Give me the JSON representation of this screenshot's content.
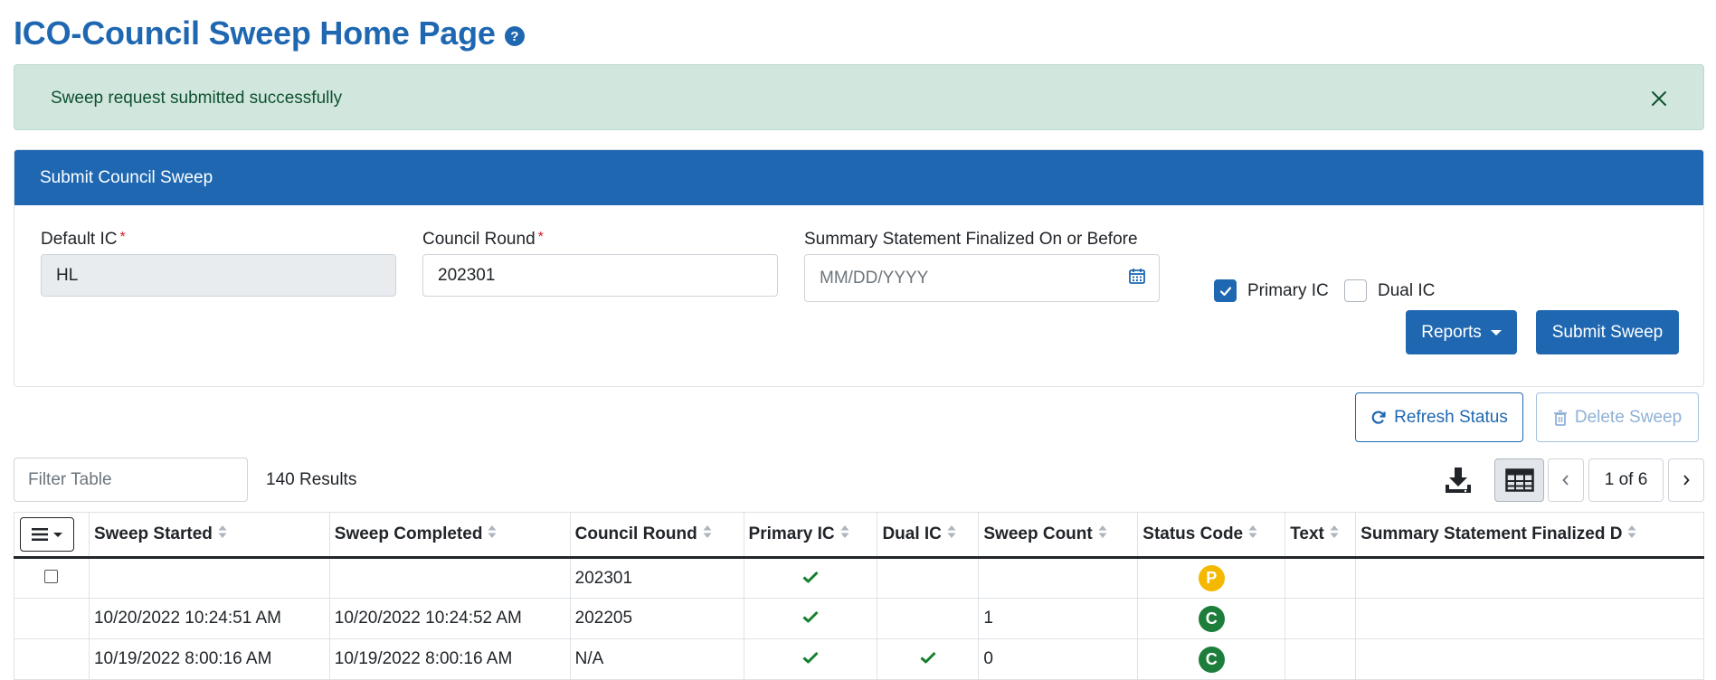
{
  "page": {
    "title": "ICO-Council Sweep Home Page"
  },
  "alert": {
    "message": "Sweep request submitted successfully"
  },
  "panel": {
    "header": "Submit Council Sweep",
    "default_ic": {
      "label": "Default IC",
      "value": "HL"
    },
    "council_round": {
      "label": "Council Round",
      "value": "202301"
    },
    "summary_date": {
      "label": "Summary Statement Finalized On or Before",
      "placeholder": "MM/DD/YYYY"
    },
    "primary_ic": {
      "label": "Primary IC",
      "checked": true
    },
    "dual_ic": {
      "label": "Dual IC",
      "checked": false
    },
    "reports_label": "Reports",
    "submit_label": "Submit Sweep"
  },
  "actions": {
    "refresh_label": "Refresh Status",
    "delete_label": "Delete Sweep"
  },
  "toolbar": {
    "filter_placeholder": "Filter Table",
    "results": "140 Results",
    "page_indicator": "1 of 6"
  },
  "table": {
    "columns": [
      "Sweep Started",
      "Sweep Completed",
      "Council Round",
      "Primary IC",
      "Dual IC",
      "Sweep Count",
      "Status Code",
      "Text",
      "Summary Statement Finalized D"
    ],
    "rows": [
      {
        "started": "",
        "completed": "",
        "round": "202301",
        "primary": true,
        "dual": false,
        "count": "",
        "status": "P",
        "text": "",
        "summary": ""
      },
      {
        "started": "10/20/2022 10:24:51 AM",
        "completed": "10/20/2022 10:24:52 AM",
        "round": "202205",
        "primary": true,
        "dual": false,
        "count": "1",
        "status": "C",
        "text": "",
        "summary": ""
      },
      {
        "started": "10/19/2022 8:00:16 AM",
        "completed": "10/19/2022 8:00:16 AM",
        "round": "N/A",
        "primary": true,
        "dual": true,
        "count": "0",
        "status": "C",
        "text": "",
        "summary": ""
      }
    ]
  },
  "colors": {
    "brand": "#1f68b1",
    "success_bg": "#d1e7dd",
    "check": "#15802e",
    "status_P": "#f5b800",
    "status_C": "#1d7d3a"
  }
}
